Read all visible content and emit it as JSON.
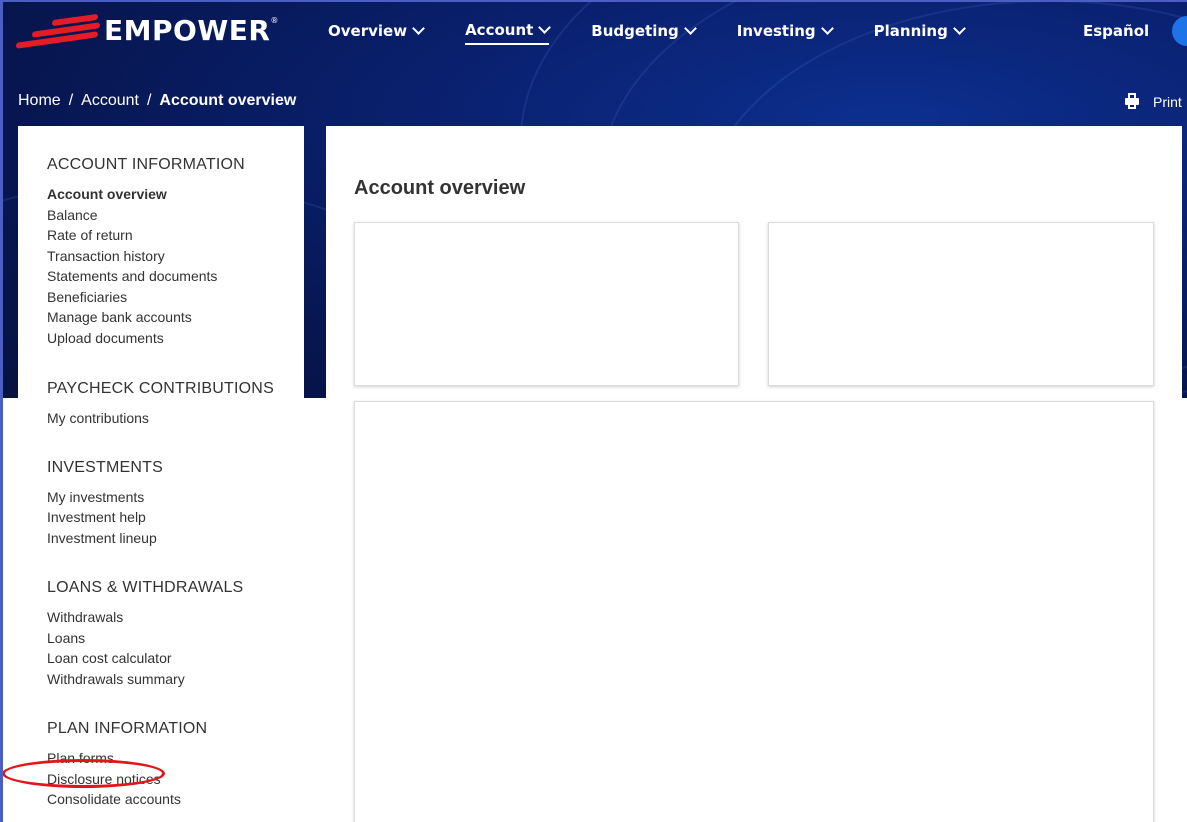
{
  "brand": {
    "name": "EMPOWER",
    "registered_mark": "®",
    "accent_color": "#e31c25",
    "header_bg": "#0a2170"
  },
  "nav": {
    "items": [
      {
        "label": "Overview",
        "active": false
      },
      {
        "label": "Account",
        "active": true
      },
      {
        "label": "Budgeting",
        "active": false
      },
      {
        "label": "Investing",
        "active": false
      },
      {
        "label": "Planning",
        "active": false
      }
    ],
    "language": "Español"
  },
  "breadcrumb": {
    "home": "Home",
    "account": "Account",
    "current": "Account overview",
    "separator": "/"
  },
  "print_label": "Print",
  "sidebar": {
    "sections": [
      {
        "heading": "ACCOUNT INFORMATION",
        "items": [
          "Account overview",
          "Balance",
          "Rate of return",
          "Transaction history",
          "Statements and documents",
          "Beneficiaries",
          "Manage bank accounts",
          "Upload documents"
        ]
      },
      {
        "heading": "PAYCHECK CONTRIBUTIONS",
        "items": [
          "My contributions"
        ]
      },
      {
        "heading": "INVESTMENTS",
        "items": [
          "My investments",
          "Investment help",
          "Investment lineup"
        ]
      },
      {
        "heading": "LOANS & WITHDRAWALS",
        "items": [
          "Withdrawals",
          "Loans",
          "Loan cost calculator",
          "Withdrawals summary"
        ]
      },
      {
        "heading": "PLAN INFORMATION",
        "items": [
          "Plan forms",
          "Disclosure notices",
          "Consolidate accounts"
        ]
      }
    ],
    "active_item": "Account overview",
    "highlighted_item": "Plan forms"
  },
  "main": {
    "title": "Account overview"
  }
}
